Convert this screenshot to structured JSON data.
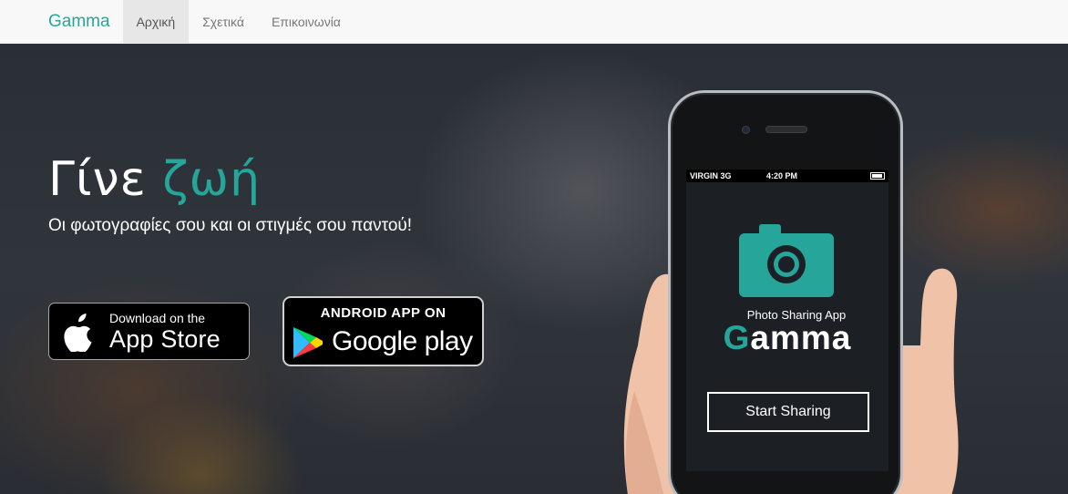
{
  "navbar": {
    "brand": "Gamma",
    "items": [
      {
        "label": "Αρχική",
        "active": true
      },
      {
        "label": "Σχετικά",
        "active": false
      },
      {
        "label": "Επικοινωνία",
        "active": false
      }
    ]
  },
  "hero": {
    "title_part1": "Γίνε ",
    "title_accent": "ζωή",
    "subtitle": "Οι φωτογραφίες σου και οι στιγμές σου παντού!"
  },
  "stores": {
    "appstore": {
      "small": "Download on the",
      "big": "App Store",
      "icon": "apple-icon"
    },
    "googleplay": {
      "top": "ANDROID APP ON",
      "bottom": "Google play",
      "icon": "google-play-icon"
    }
  },
  "phone": {
    "status": {
      "carrier": "VIRGIN  3G",
      "time": "4:20 PM"
    },
    "app_subtitle": "Photo Sharing App",
    "app_name_first": "G",
    "app_name_rest": "amma",
    "start_button": "Start Sharing",
    "icon": "camera-icon"
  },
  "colors": {
    "accent": "#26a69a",
    "navbar_bg": "#f8f8f8",
    "nav_active_bg": "#e7e7e7"
  }
}
